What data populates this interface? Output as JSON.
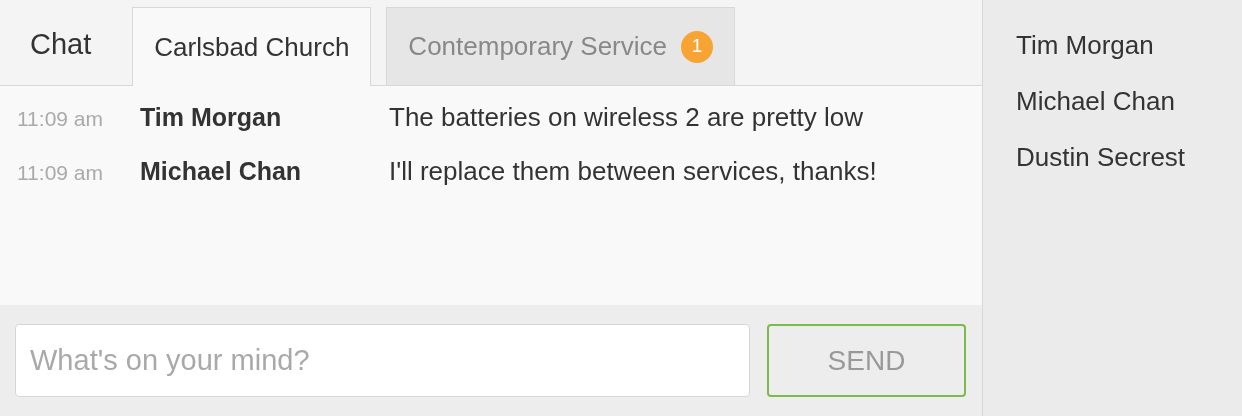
{
  "chat_label": "Chat",
  "tabs": [
    {
      "label": "Carlsbad Church",
      "selected": true
    },
    {
      "label": "Contemporary Service",
      "selected": false,
      "badge": "1"
    }
  ],
  "messages": [
    {
      "time": "11:09 am",
      "author": "Tim Morgan",
      "text": "The batteries on wireless 2 are pretty low"
    },
    {
      "time": "11:09 am",
      "author": "Michael Chan",
      "text": "I'll replace them between services, thanks!"
    }
  ],
  "composer": {
    "placeholder": "What's on your mind?",
    "send": "SEND"
  },
  "participants": [
    "Tim Morgan",
    "Michael Chan",
    "Dustin Secrest"
  ]
}
